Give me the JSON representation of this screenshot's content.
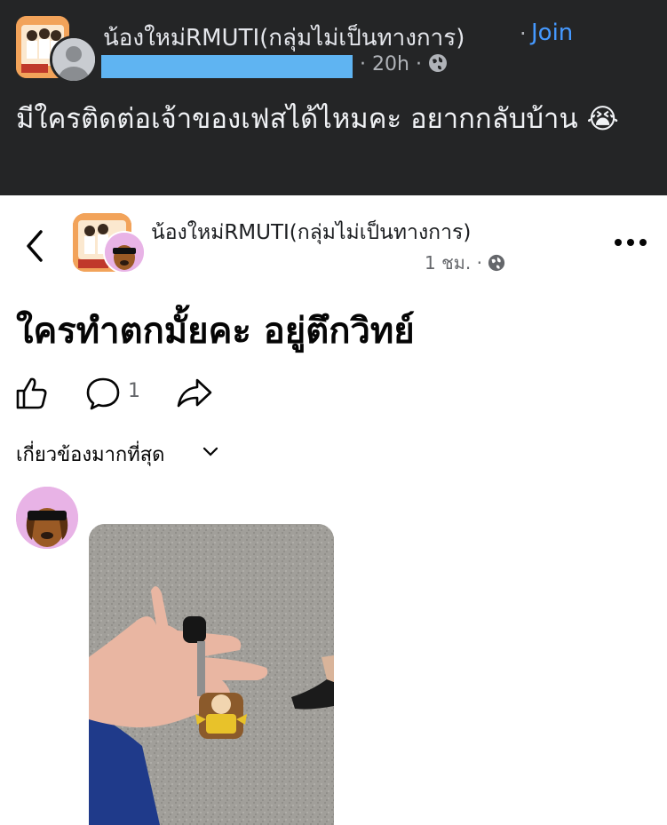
{
  "outer_post": {
    "group_name": "น้องใหม่RMUTI(กลุ่มไม่เป็นทางการ)",
    "separator": "·",
    "join_label": "Join",
    "timestamp": "20h",
    "post_text": "มีใครติดต่อเจ้าของเฟสได้ไหมคะ อยากกลับบ้าน 😭",
    "icons": [
      "group-icon",
      "avatar",
      "globe-icon"
    ]
  },
  "inner_post": {
    "group_name": "น้องใหม่RMUTI(กลุ่มไม่เป็นทางการ)",
    "timestamp": "1 ชม.",
    "separator": "·",
    "title": "ใครทำตกมั้ยคะ อยู่ตึกวิทย์",
    "comment_count": "1",
    "sort_label": "เกี่ยวข้องมากที่สุด",
    "icons": [
      "back-icon",
      "more-icon",
      "like-icon",
      "comment-icon",
      "share-icon",
      "chevron-down-icon"
    ]
  },
  "colors": {
    "dark_bg": "#242526",
    "join_blue": "#4599ff",
    "redaction": "#5fb4f2",
    "group_orange": "#e8873a"
  }
}
